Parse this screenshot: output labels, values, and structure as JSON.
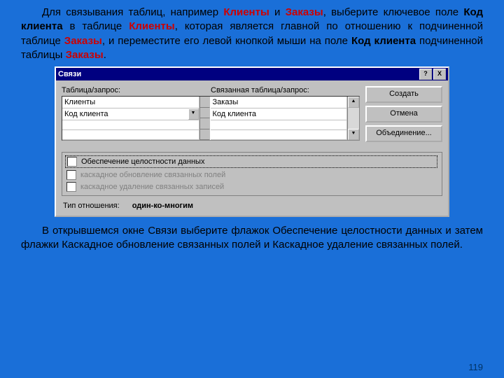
{
  "para1_pre": "Для связывания таблиц, например ",
  "hl1": "Клиенты",
  "para1_a": " и ",
  "hl2": "Заказы",
  "para1_b": ", выберите ключевое поле ",
  "hl3": "Код клиента",
  "para1_c": " в таблице ",
  "hl4": "Клиенты",
  "para1_d": ", которая является главной по отношению к подчиненной таблице ",
  "hl5": "Заказы",
  "para1_e": ", и переместите его левой кнопкой мыши на поле ",
  "hl6": "Код клиента",
  "para1_f": " подчиненной таблицы ",
  "hl7": "Заказы",
  "para1_g": ".",
  "dialog": {
    "title": "Связи",
    "btn_help": "?",
    "btn_close": "X",
    "lbl_left": "Таблица/запрос:",
    "lbl_right": "Связанная таблица/запрос:",
    "col1_r1": "Клиенты",
    "col1_r2": "Код клиента",
    "col2_r1": "Заказы",
    "col2_r2": "Код клиента",
    "btn_create": "Создать",
    "btn_cancel": "Отмена",
    "btn_join": "Объединение...",
    "chk1": "Обеспечение целостности данных",
    "chk2": "каскадное обновление связанных полей",
    "chk3": "каскадное удаление связанных записей",
    "rel_label": "Тип отношения:",
    "rel_value": "один-ко-многим"
  },
  "para2": "В открывшемся окне Связи выберите флажок Обеспечение целостности данных и затем флажки Каскадное обновление связанных полей и Каскадное удаление связанных полей.",
  "page_num": "119"
}
